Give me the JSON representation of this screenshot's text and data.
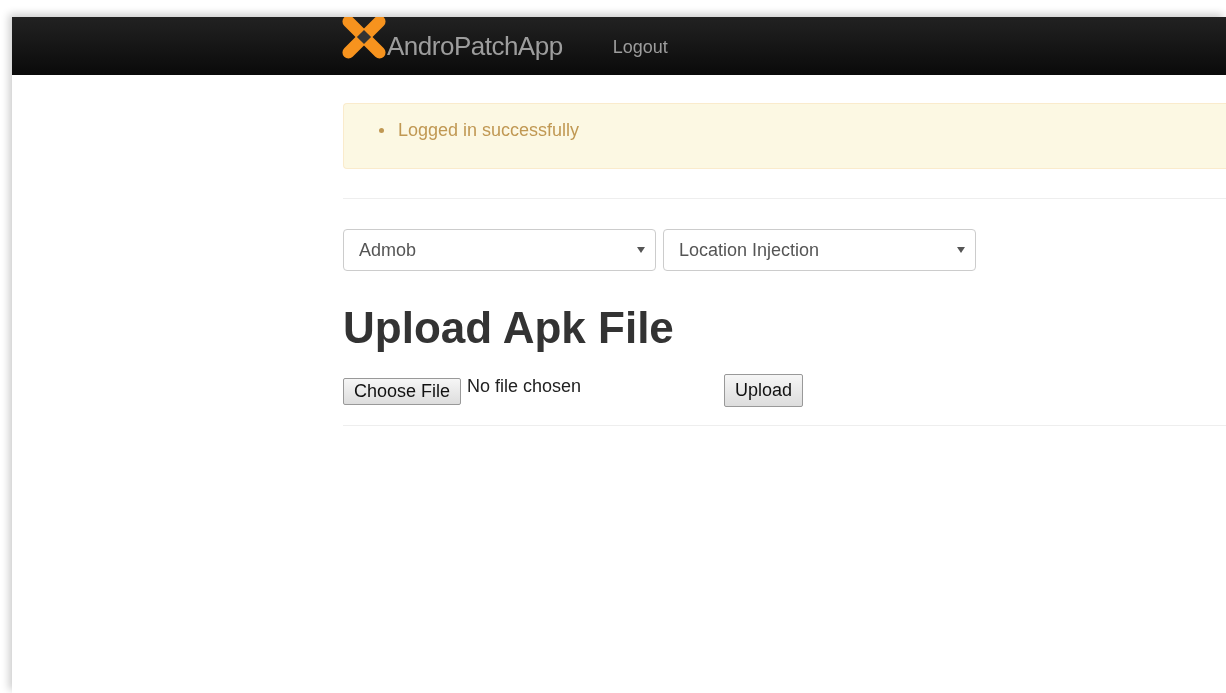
{
  "navbar": {
    "brand": "AndroPatchApp",
    "links": [
      {
        "label": "Logout"
      }
    ]
  },
  "alert": {
    "messages": [
      "Logged in successfully"
    ]
  },
  "selects": [
    {
      "value": "Admob"
    },
    {
      "value": "Location Injection"
    }
  ],
  "upload": {
    "heading": "Upload Apk File",
    "choose_button": "Choose File",
    "file_status": "No file chosen",
    "submit_button": "Upload"
  }
}
